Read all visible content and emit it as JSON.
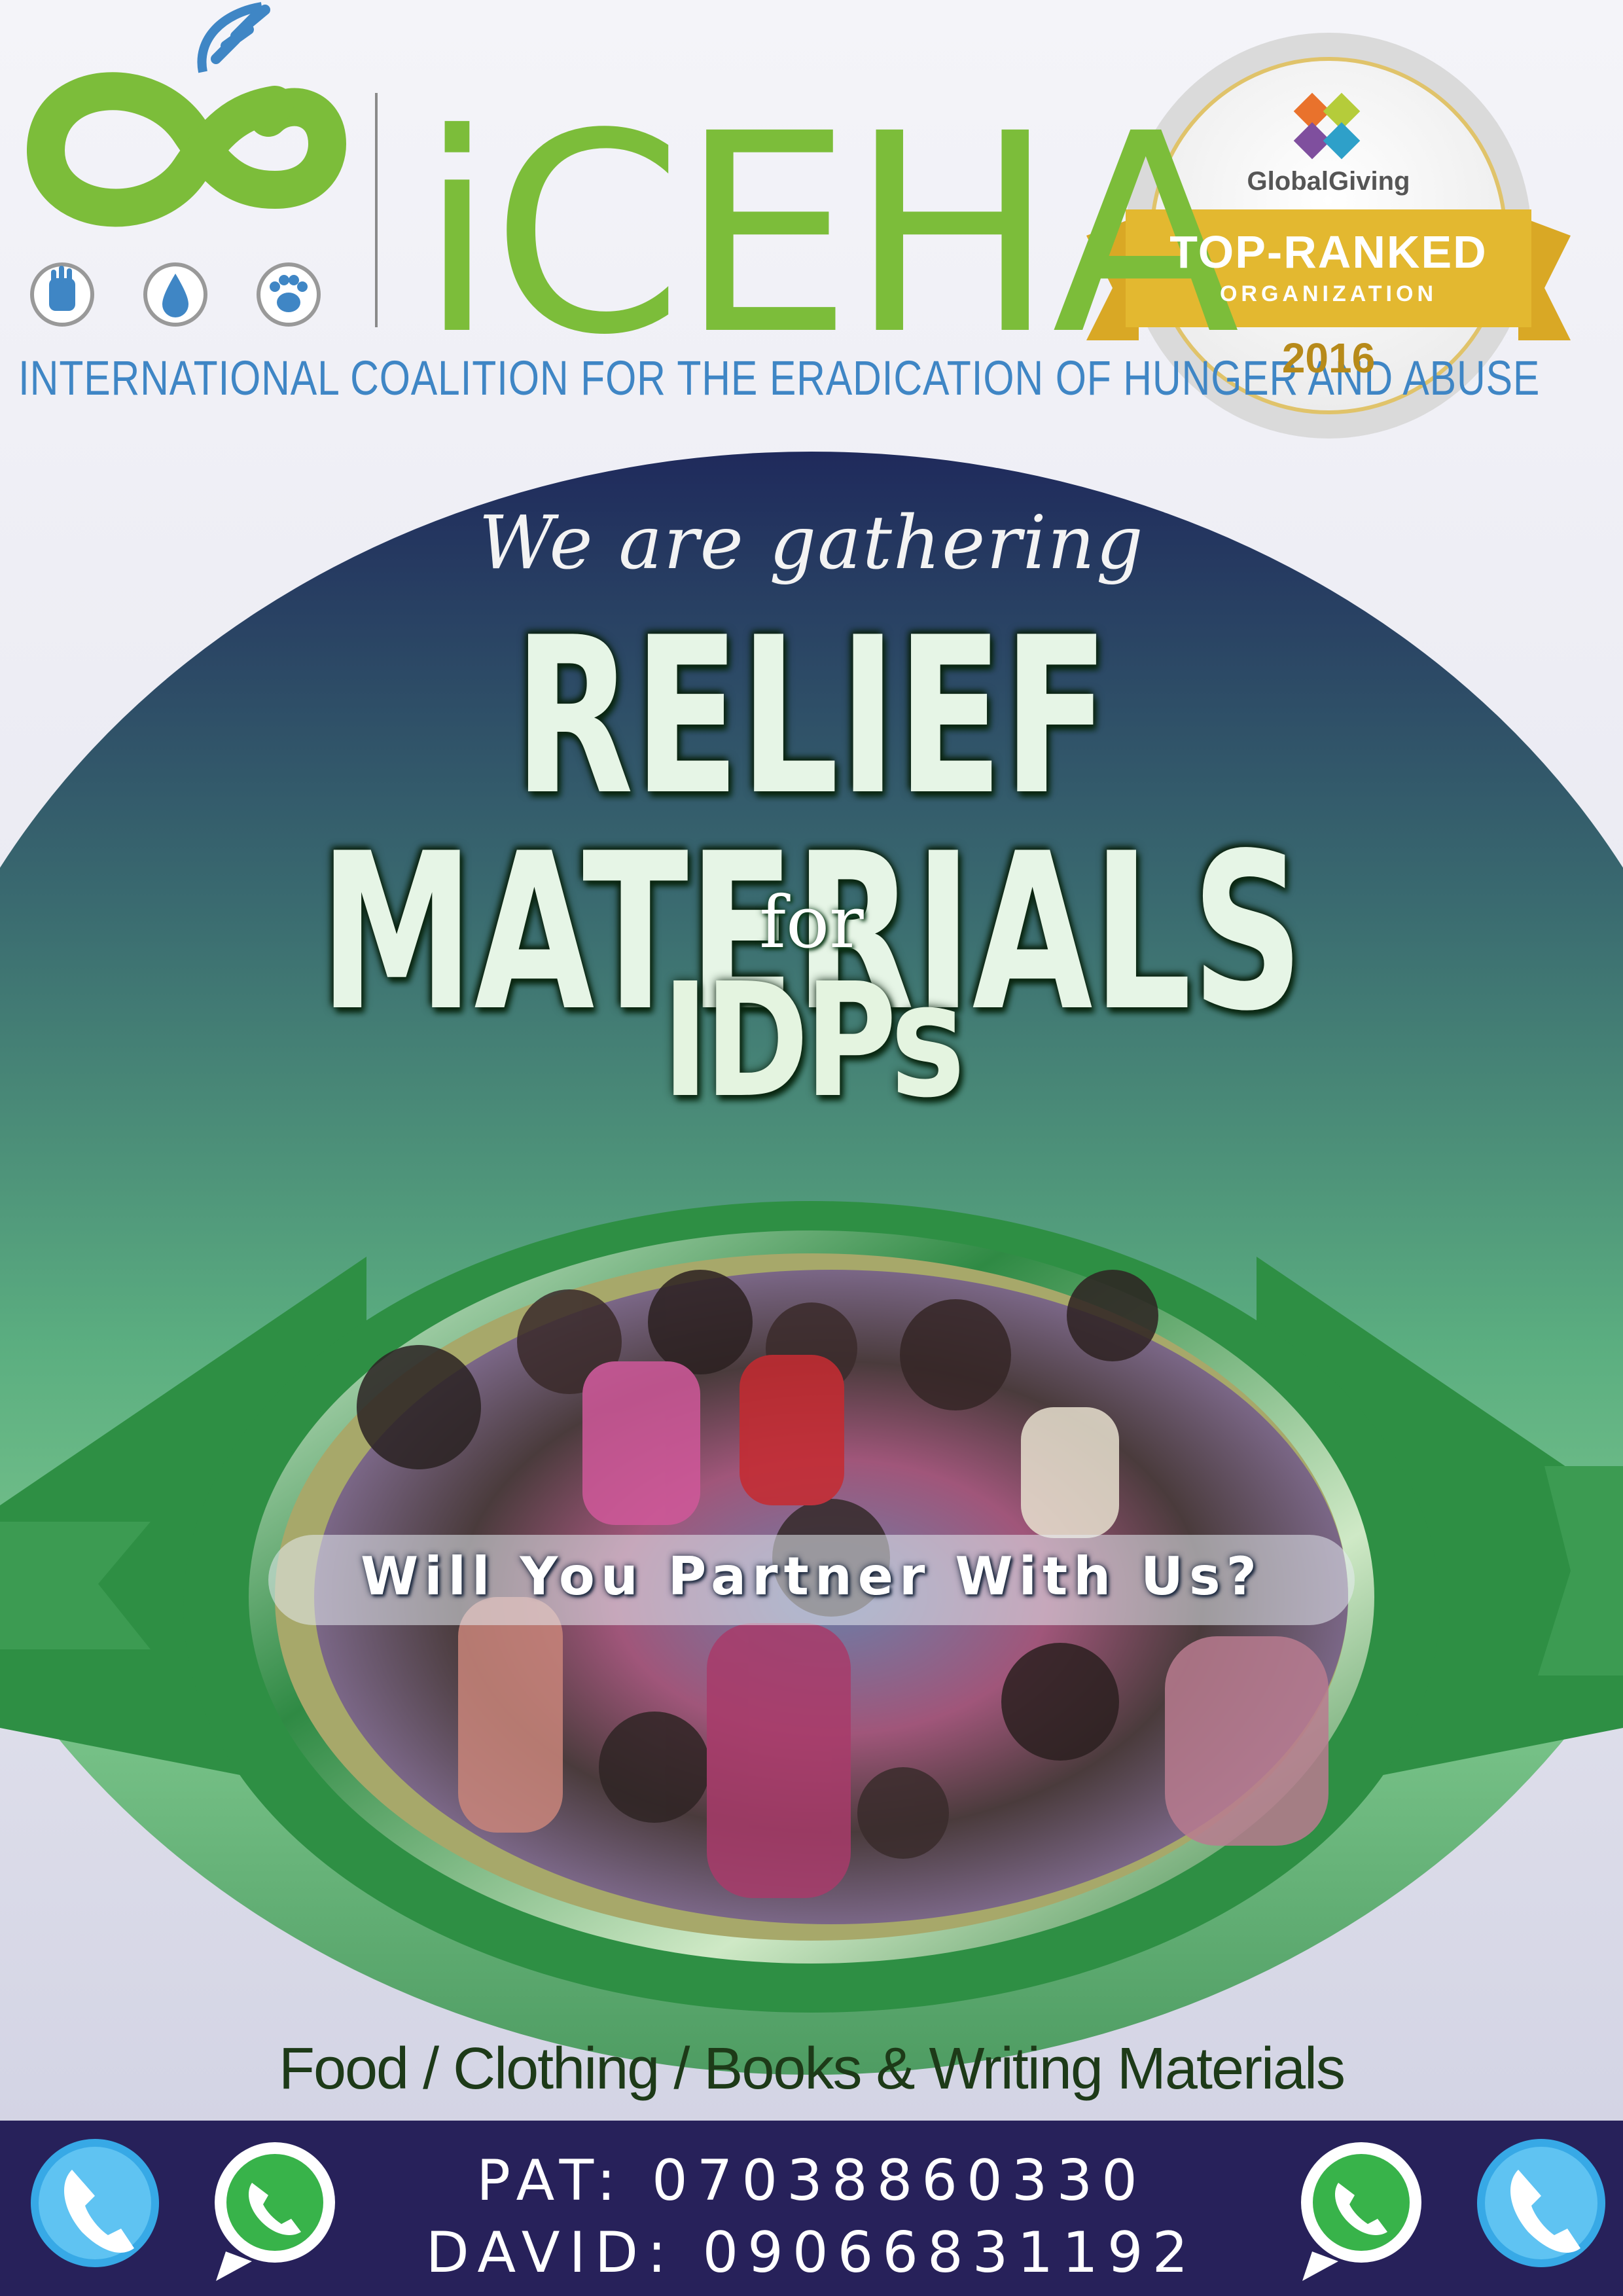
{
  "org": {
    "name": "iCEHA",
    "tagline": "INTERNATIONAL COALITION FOR THE ERADICATION OF HUNGER AND ABUSE",
    "icons": [
      "hand-icon",
      "water-drop-icon",
      "paw-icon"
    ]
  },
  "badge": {
    "brand": "GlobalGiving",
    "title": "TOP-RANKED",
    "subtitle": "ORGANIZATION",
    "year": "2016"
  },
  "headline": {
    "intro": "We are gathering",
    "main": "RELIEF MATERIALS",
    "connector": "for",
    "target": "IDPs"
  },
  "call_to_action": "Will You Partner With Us?",
  "items_needed": "Food / Clothing / Books & Writing Materials",
  "contacts": [
    {
      "line": "PAT: 07038860330"
    },
    {
      "line": "DAVID: 09066831192"
    }
  ],
  "colors": {
    "brand_green": "#7cbd3a",
    "brand_blue": "#3f86c5",
    "navy": "#27215a",
    "ribbon_gold": "#e3b830",
    "panel_green": "#2e8f44"
  }
}
